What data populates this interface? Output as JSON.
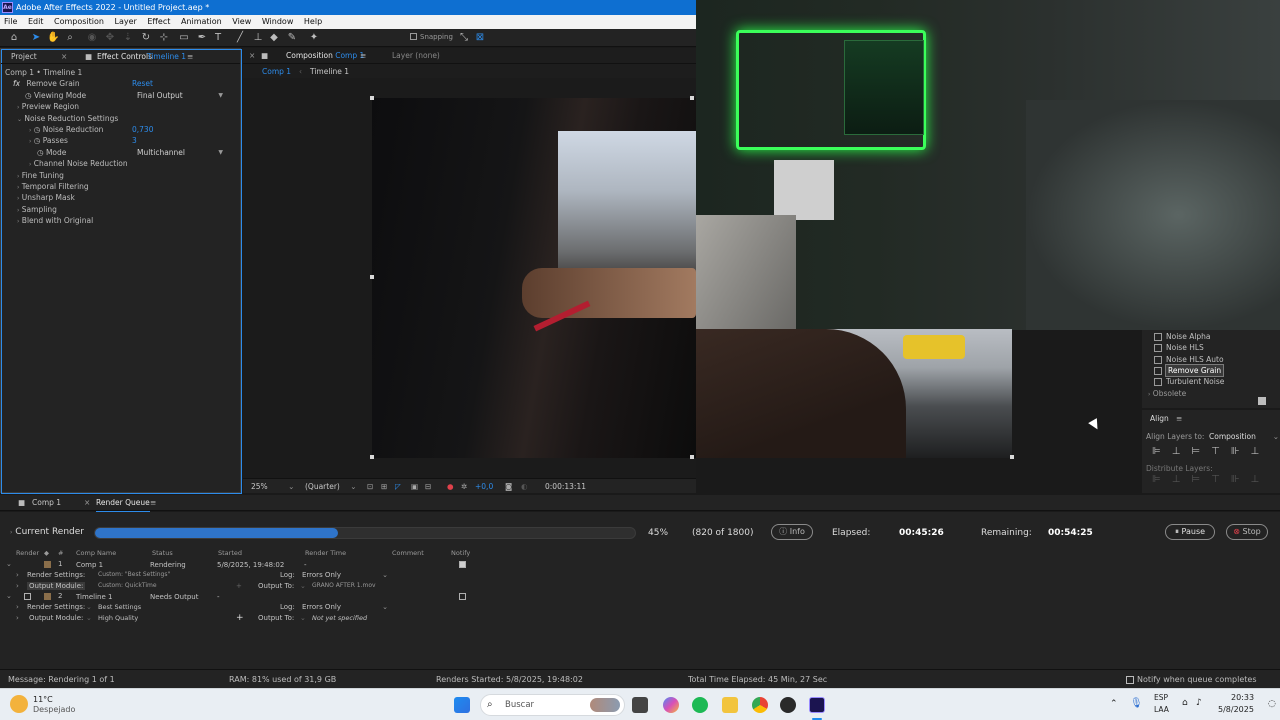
{
  "window": {
    "title": "Adobe After Effects 2022 - Untitled Project.aep *",
    "logo": "Ae"
  },
  "menu": [
    "File",
    "Edit",
    "Composition",
    "Layer",
    "Effect",
    "Animation",
    "View",
    "Window",
    "Help"
  ],
  "toolbar": {
    "snapping_label": "Snapping"
  },
  "left_panel": {
    "tab_project": "Project",
    "tab_effect_controls": "Effect Controls",
    "tab_effect_controls_target": "Timeline 1",
    "breadcrumb": "Comp 1 • Timeline 1",
    "effect_name": "Remove Grain",
    "reset_label": "Reset",
    "viewing_mode_label": "Viewing Mode",
    "viewing_mode_value": "Final Output",
    "preview_region": "Preview Region",
    "noise_reduction_settings": "Noise Reduction Settings",
    "noise_reduction_label": "Noise Reduction",
    "noise_reduction_value": "0,730",
    "passes_label": "Passes",
    "passes_value": "3",
    "mode_label": "Mode",
    "mode_value": "Multichannel",
    "channel_noise_reduction": "Channel Noise Reduction",
    "fine_tuning": "Fine Tuning",
    "temporal_filtering": "Temporal Filtering",
    "unsharp_mask": "Unsharp Mask",
    "sampling": "Sampling",
    "blend_with_original": "Blend with Original"
  },
  "comp_panel": {
    "tab_label": "Composition",
    "tab_target": "Comp 1",
    "layer_tab": "Layer (none)",
    "subtab_comp": "Comp 1",
    "subtab_timeline": "Timeline 1",
    "zoom": "25%",
    "resolution": "(Quarter)",
    "exposure": "+0,0",
    "timecode": "0:00:13:11"
  },
  "effects_list": {
    "items": [
      "Noise Alpha",
      "Noise HLS",
      "Noise HLS Auto",
      "Remove Grain",
      "Turbulent Noise"
    ],
    "selected": "Remove Grain",
    "obsolete": "Obsolete"
  },
  "align_panel": {
    "title": "Align",
    "align_layers_to_label": "Align Layers to:",
    "align_layers_to_value": "Composition",
    "distribute_layers": "Distribute Layers:"
  },
  "bottom_tabs": {
    "comp": "Comp 1",
    "render_queue": "Render Queue"
  },
  "render": {
    "current_render_label": "Current Render",
    "progress_percent": 45,
    "percent_text": "45%",
    "frames_text": "(820 of 1800)",
    "info_label": "Info",
    "elapsed_label": "Elapsed:",
    "elapsed_value": "00:45:26",
    "remaining_label": "Remaining:",
    "remaining_value": "00:54:25",
    "pause_label": "Pause",
    "stop_label": "Stop"
  },
  "queue": {
    "headers": {
      "render": "Render",
      "num": "#",
      "comp_name": "Comp Name",
      "status": "Status",
      "started": "Started",
      "render_time": "Render Time",
      "comment": "Comment",
      "notify": "Notify"
    },
    "items": [
      {
        "num": "1",
        "comp_name": "Comp 1",
        "status": "Rendering",
        "started": "5/8/2025, 19:48:02",
        "render_time": "-",
        "render_settings_label": "Render Settings:",
        "render_settings_value": "Custom: \"Best Settings\"",
        "output_module_label": "Output Module:",
        "output_module_value": "Custom: QuickTime",
        "log_label": "Log:",
        "log_value": "Errors Only",
        "output_to_label": "Output To:",
        "output_to_value": "GRANO AFTER 1.mov"
      },
      {
        "num": "2",
        "comp_name": "Timeline 1",
        "status": "Needs Output",
        "started": "-",
        "render_time": "",
        "render_settings_label": "Render Settings:",
        "render_settings_value": "Best Settings",
        "output_module_label": "Output Module:",
        "output_module_value": "High Quality",
        "log_label": "Log:",
        "log_value": "Errors Only",
        "output_to_label": "Output To:",
        "output_to_value": "Not yet specified"
      }
    ]
  },
  "status": {
    "message": "Message:  Rendering 1 of 1",
    "ram": "RAM:  81% used of 31,9 GB",
    "renders_started": "Renders Started:  5/8/2025, 19:48:02",
    "total_time": "Total Time Elapsed:  45 Min, 27 Sec",
    "notify": "Notify when queue completes"
  },
  "taskbar": {
    "weather_temp": "11°C",
    "weather_desc": "Despejado",
    "search_placeholder": "Buscar",
    "lang1": "ESP",
    "lang2": "LAA",
    "time": "20:33",
    "date": "5/8/2025"
  },
  "colors": {
    "accent_blue": "#2d8ceb",
    "title_blue": "#0e6fd1",
    "progress": "#2f74c9",
    "stop_red": "#e0414b"
  }
}
